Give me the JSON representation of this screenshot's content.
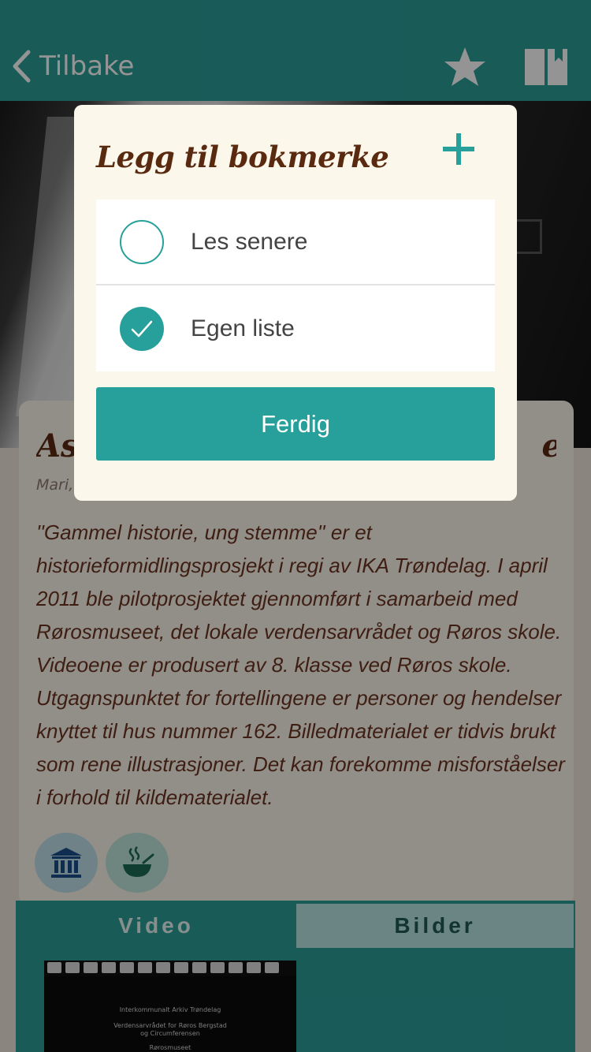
{
  "navbar": {
    "back_label": "Tilbake",
    "back_icon": "chevron-left-icon",
    "favorite_icon": "star-icon",
    "bookmark_icon": "book-bookmark-icon",
    "color": "#2a9d97"
  },
  "article": {
    "title_visible_start": "Asp",
    "title_visible_end": "e",
    "author_visible": "Mari,",
    "description": "''Gammel historie, ung stemme'' er et historieformidlingsprosjekt i regi av IKA Trøndelag. I april 2011 ble pilotprosjektet gjennomført i samarbeid med Rørosmuseet, det lokale verdensarvrådet og Røros skole. Videoene er produsert av 8. klasse ved Røros skole. Utgagnspunktet for fortellingene er personer og hendelser knyttet til hus nummer 162. Billedmaterialet er tidvis brukt som rene illustrasjoner. Det kan forekomme misforståelser i forhold til kildematerialet.",
    "categories": [
      {
        "icon": "museum-icon"
      },
      {
        "icon": "food-bowl-icon"
      }
    ]
  },
  "tabs": [
    {
      "label": "Video",
      "active": true
    },
    {
      "label": "Bilder",
      "active": false
    }
  ],
  "video_thumbnail": {
    "line1": "Interkommunalt Arkiv Trøndelag",
    "line2": "Verdensarvrådet  for Røros Bergstad",
    "line3": "og Circumferensen",
    "line4": "Rørosmuseet"
  },
  "modal": {
    "title": "Legg til bokmerke",
    "add_icon": "plus-icon",
    "lists": [
      {
        "label": "Les senere",
        "checked": false
      },
      {
        "label": "Egen liste",
        "checked": true
      }
    ],
    "done_label": "Ferdig",
    "accent": "#27a09b"
  }
}
